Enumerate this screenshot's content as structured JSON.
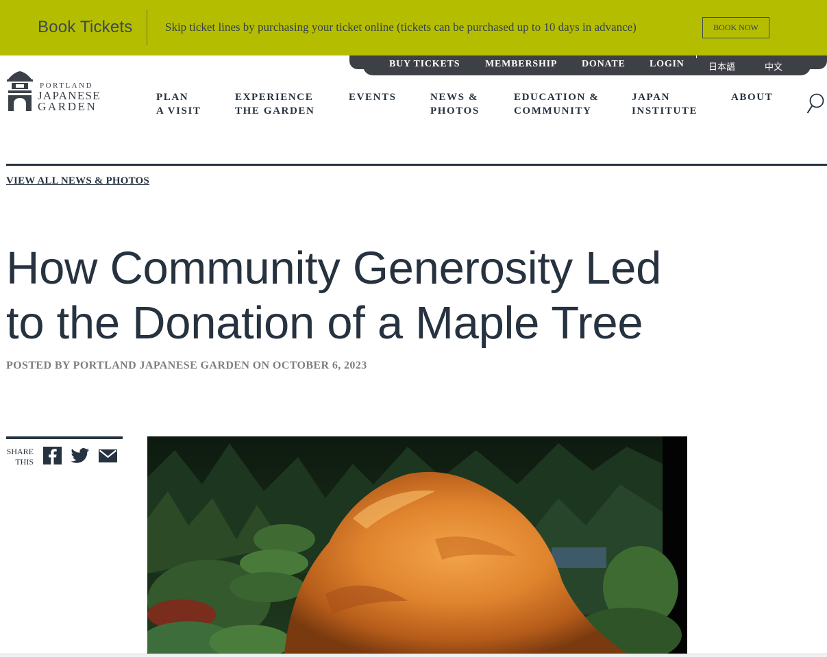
{
  "promo": {
    "title": "Book Tickets",
    "text": "Skip ticket lines by purchasing your ticket online (tickets can be purchased up to 10 days in advance)",
    "button": "BOOK NOW",
    "bg_color": "#b5bd00"
  },
  "utility_nav": {
    "items": [
      "BUY TICKETS",
      "MEMBERSHIP",
      "DONATE",
      "LOGIN"
    ],
    "languages": [
      "日本語",
      "中文"
    ]
  },
  "logo": {
    "line1": "PORTLAND",
    "line2": "JAPANESE",
    "line3": "GARDEN"
  },
  "main_nav": {
    "items": [
      {
        "line1": "PLAN",
        "line2": "A VISIT"
      },
      {
        "line1": "EXPERIENCE",
        "line2": "THE GARDEN"
      },
      {
        "line1": "EVENTS",
        "line2": ""
      },
      {
        "line1": "NEWS &",
        "line2": "PHOTOS"
      },
      {
        "line1": "EDUCATION &",
        "line2": "COMMUNITY"
      },
      {
        "line1": "JAPAN",
        "line2": "INSTITUTE"
      },
      {
        "line1": "ABOUT",
        "line2": ""
      }
    ],
    "search_icon": "search-icon"
  },
  "article": {
    "back_link": "VIEW ALL NEWS & PHOTOS",
    "title_line1": "How Community Generosity Led",
    "title_line2": "to the Donation of a Maple Tree",
    "byline": "POSTED BY PORTLAND JAPANESE GARDEN ON OCTOBER 6, 2023"
  },
  "share": {
    "label_line1": "SHARE",
    "label_line2": "THIS",
    "icons": [
      "facebook-icon",
      "twitter-icon",
      "email-icon"
    ]
  },
  "colors": {
    "text_dark": "#26323f",
    "util_bar": "#3d4146",
    "byline_gray": "#7e7e7e"
  }
}
